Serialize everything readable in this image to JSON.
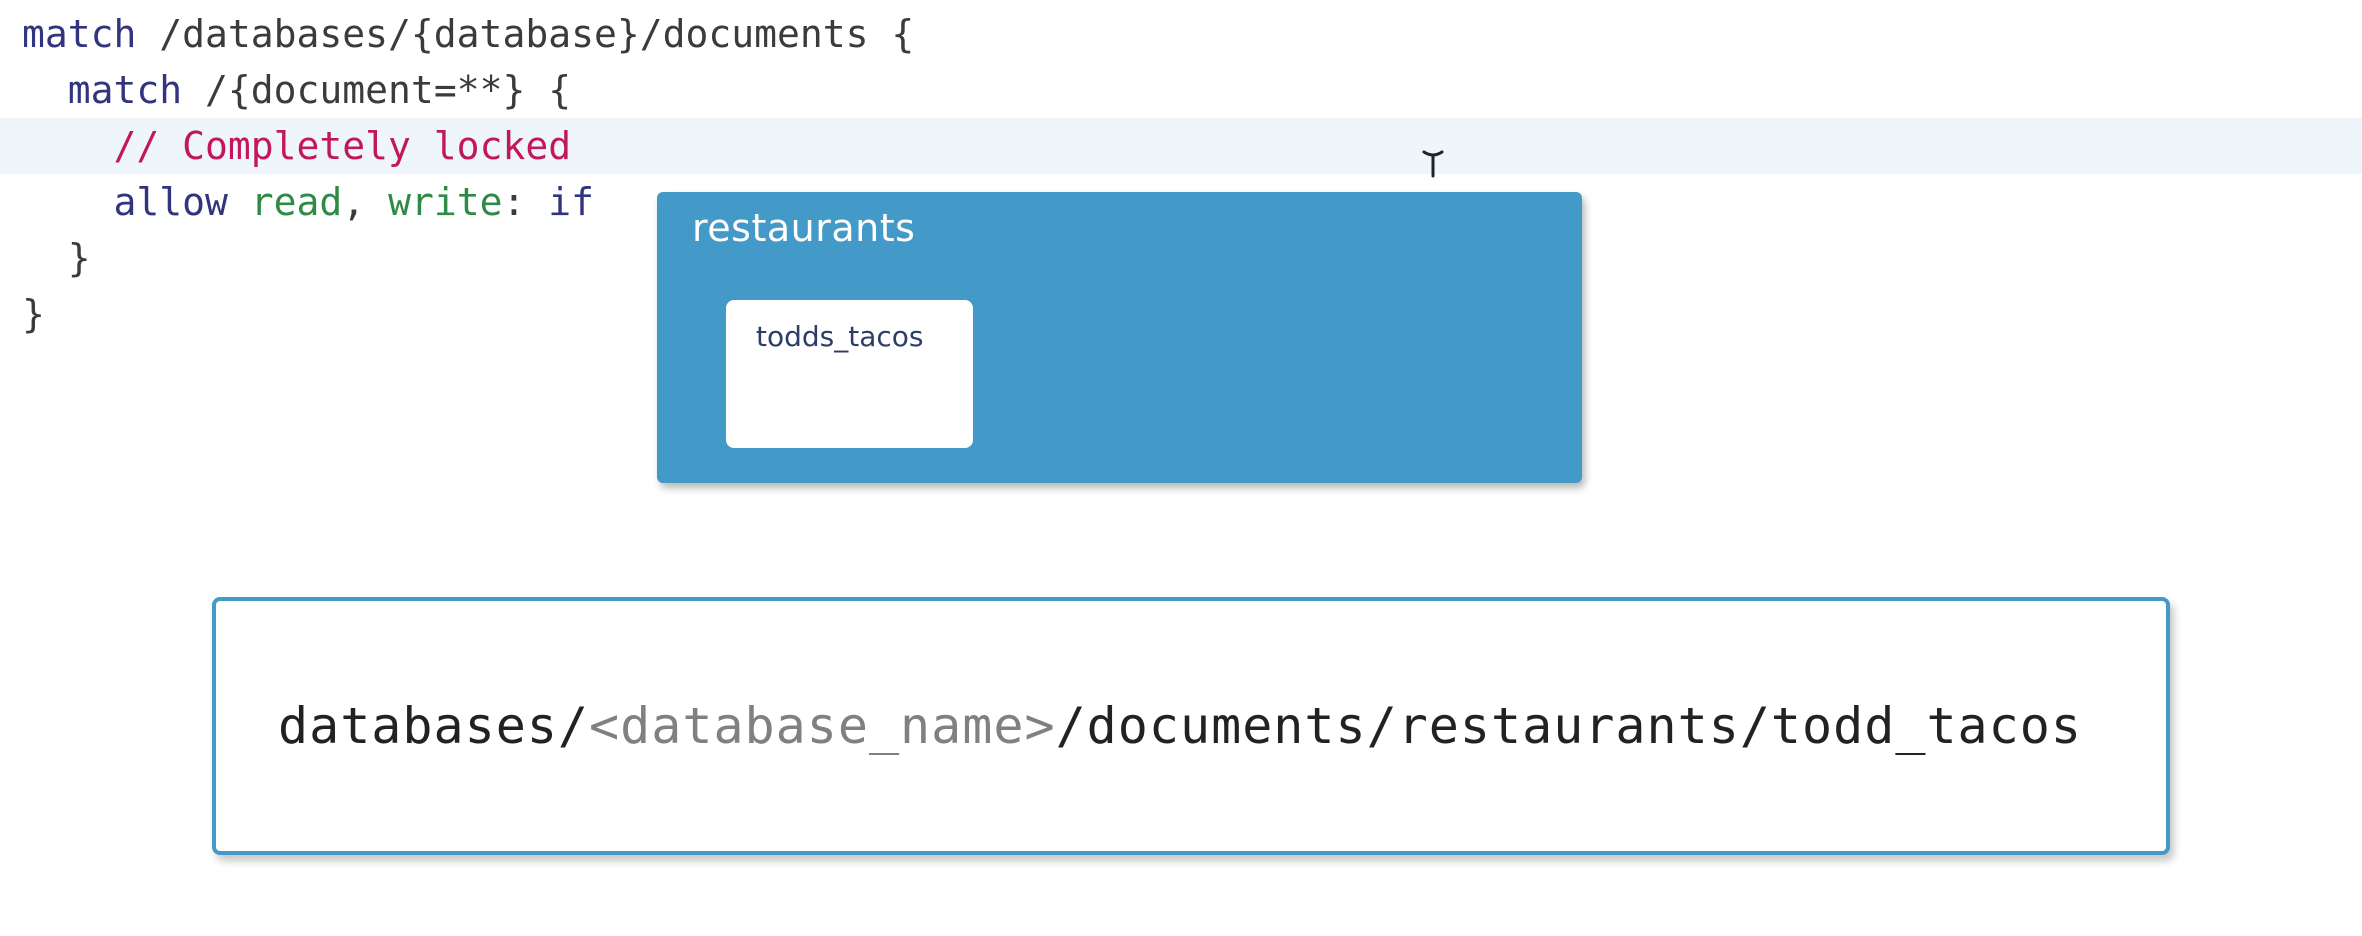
{
  "code": {
    "line1": {
      "kw": "match",
      "path": " /databases/{database}/documents {"
    },
    "line2": {
      "indent": "  ",
      "kw": "match",
      "path": " /{document=**} {"
    },
    "line3": {
      "indent": "    ",
      "comment": "// Completely locked"
    },
    "line4": {
      "indent": "    ",
      "kw": "allow",
      "read": " read",
      "comma": ",",
      "write": " write",
      "colon": ":",
      "if": " if"
    },
    "line5": {
      "text": "  }"
    },
    "line6": {
      "text": "}"
    }
  },
  "collection": {
    "name": "restaurants",
    "document": "todds_tacos"
  },
  "path": {
    "prefix": "databases/",
    "placeholder": "<database_name>",
    "suffix": "/documents/restaurants/todd_tacos"
  },
  "colors": {
    "collection_bg": "#4399c8",
    "comment": "#c2185b",
    "keyword": "#32357e",
    "green": "#2e8b46",
    "highlight": "#eef6fb"
  }
}
